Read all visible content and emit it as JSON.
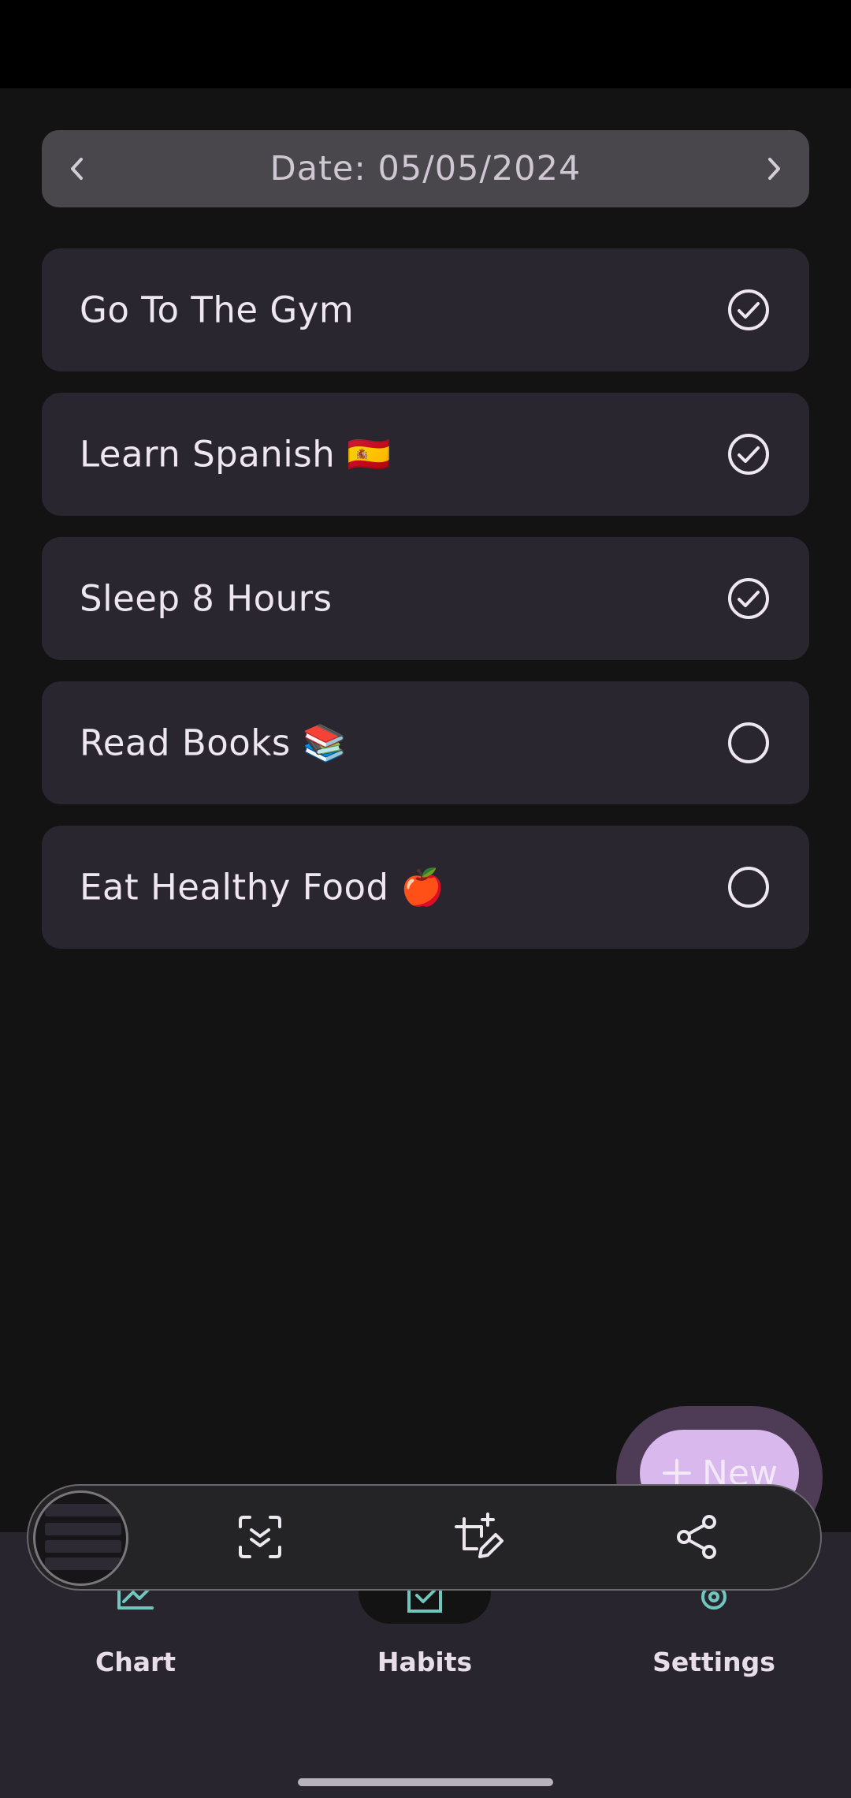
{
  "header": {
    "date_text": "Date: 05/05/2024",
    "prev_icon": "chevron-left-icon",
    "next_icon": "chevron-right-icon"
  },
  "habits": [
    {
      "label": "Go To The Gym",
      "completed": true
    },
    {
      "label": "Learn Spanish 🇪🇸",
      "completed": true
    },
    {
      "label": "Sleep 8 Hours",
      "completed": true
    },
    {
      "label": "Read Books 📚",
      "completed": false
    },
    {
      "label": "Eat Healthy Food 🍎",
      "completed": false
    }
  ],
  "fab": {
    "label": "New",
    "icon": "plus-icon"
  },
  "bottom_nav": {
    "items": [
      {
        "label": "Chart",
        "icon": "chart-icon"
      },
      {
        "label": "Habits",
        "icon": "habits-icon",
        "selected": true
      },
      {
        "label": "Settings",
        "icon": "gear-icon"
      }
    ]
  },
  "screenshot_toolbar": {
    "actions": [
      "scroll-capture-icon",
      "crop-edit-icon",
      "share-icon"
    ]
  },
  "colors": {
    "background": "#141314",
    "card": "#2A2630",
    "date_bar": "#4A474C",
    "accent": "#D9B8EE",
    "nav_background": "#29252E",
    "nav_icon": "#6FC7BE"
  }
}
